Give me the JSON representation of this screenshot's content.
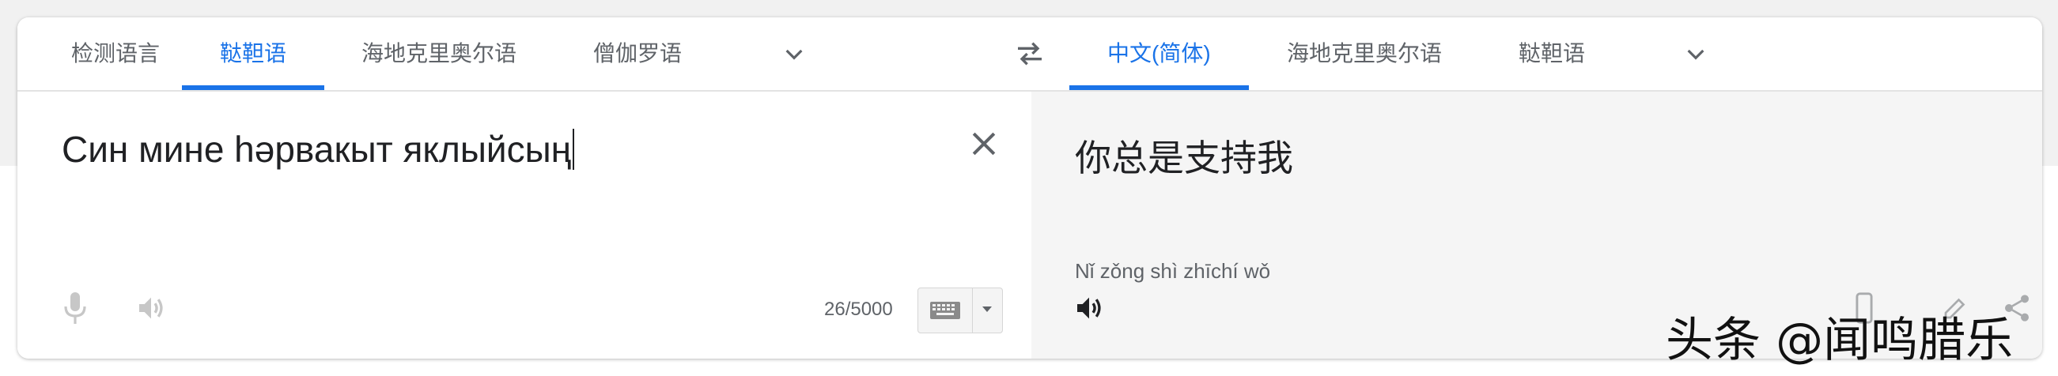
{
  "source_languages": {
    "tabs": [
      {
        "label": "检测语言",
        "active": false
      },
      {
        "label": "鞑靼语",
        "active": true
      },
      {
        "label": "海地克里奥尔语",
        "active": false
      },
      {
        "label": "僧伽罗语",
        "active": false
      }
    ],
    "more_icon": "chevron-down-icon"
  },
  "swap_icon": "swap-horiz-icon",
  "target_languages": {
    "tabs": [
      {
        "label": "中文(简体)",
        "active": true
      },
      {
        "label": "海地克里奥尔语",
        "active": false
      },
      {
        "label": "鞑靼语",
        "active": false
      }
    ],
    "more_icon": "chevron-down-icon"
  },
  "source": {
    "text": "Син мине һәрвакыт яклыйсың",
    "char_count": "26/5000",
    "clear_icon": "close-icon",
    "mic_icon": "mic-icon",
    "speaker_icon": "volume-icon",
    "keyboard_icon": "keyboard-icon"
  },
  "target": {
    "text": "你总是支持我",
    "romanization": "Nǐ zǒng shì zhīchí wǒ",
    "speaker_icon": "volume-icon"
  },
  "watermark": "头条 @闻鸣腊乐",
  "colors": {
    "accent": "#1a73e8",
    "muted": "#5f6368",
    "target_bg": "#f5f5f5"
  }
}
